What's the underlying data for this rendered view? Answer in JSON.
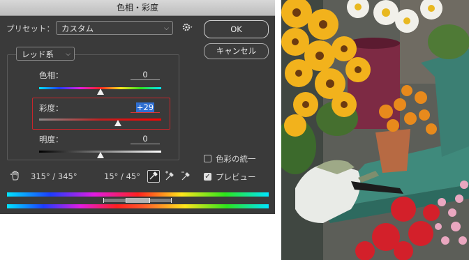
{
  "dialog": {
    "title": "色相・彩度",
    "preset_label": "プリセット：",
    "preset_value": "カスタム",
    "ok_label": "OK",
    "cancel_label": "キャンセル",
    "channel_value": "レッド系",
    "hue_label": "色相：",
    "hue_value": "0",
    "saturation_label": "彩度：",
    "saturation_value": "+29",
    "lightness_label": "明度：",
    "lightness_value": "0",
    "colorize_label": "色彩の統一",
    "preview_label": "プレビュー",
    "range_left": "315° / 345°",
    "range_right": "15° / 45°",
    "hue_level": 0.5,
    "saturation_level": 0.645,
    "lightness_level": 0.5,
    "colorize_checked": false,
    "preview_checked": true,
    "highlight_color": "#c8262b",
    "selection_color": "#2f6fd2"
  },
  "icons": {
    "gear": "gear-icon",
    "hand": "targeted-adjust-icon",
    "eyedropper": "eyedropper-icon",
    "eyedropper_plus": "eyedropper-plus-icon",
    "eyedropper_minus": "eyedropper-minus-icon"
  }
}
